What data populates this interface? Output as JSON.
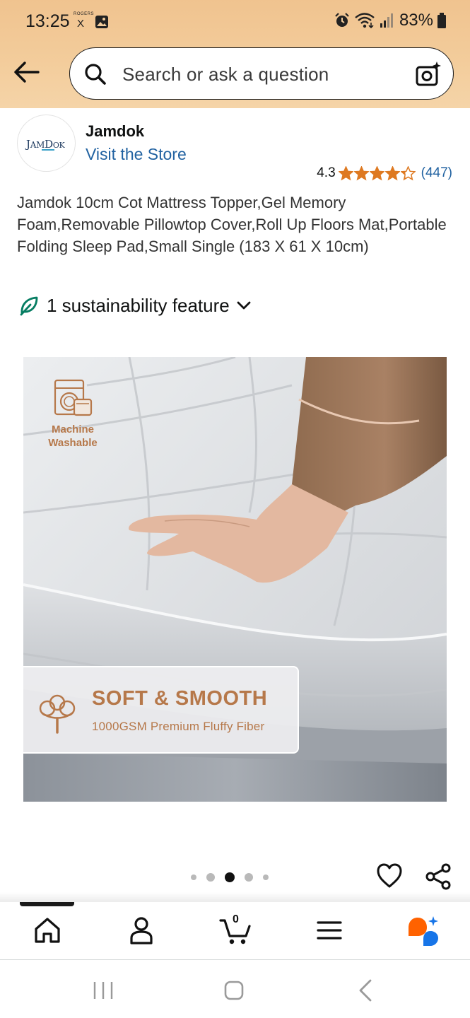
{
  "status_bar": {
    "time": "13:25",
    "carrier_label": "ROGERS",
    "carrier_mark": "X",
    "battery": "83%"
  },
  "search": {
    "placeholder": "Search or ask a question"
  },
  "brand": {
    "logo_text": "JAMDOK",
    "name": "Jamdok",
    "visit_store": "Visit the Store"
  },
  "rating": {
    "value": "4.3",
    "stars": 4.3,
    "max_stars": 5,
    "count": "(447)",
    "star_color": "#de7921"
  },
  "product": {
    "title": "Jamdok 10cm Cot Mattress Topper,Gel Memory Foam,Removable Pillowtop Cover,Roll Up Floors Mat,Portable Folding Sleep Pad,Small Single (183 X 61 X 10cm)"
  },
  "sustainability": {
    "label": "1 sustainability feature",
    "icon": "leaf-icon",
    "color": "#067d62"
  },
  "image": {
    "badge_label": "Machine Washable",
    "panel_title": "SOFT & SMOOTH",
    "panel_subtitle": "1000GSM Premium Fluffy Fiber",
    "accent_color": "#b6784a"
  },
  "carousel": {
    "total_images": 5,
    "active_index": 2
  },
  "bottom_nav": {
    "cart_count": "0",
    "items": [
      "home-icon",
      "account-icon",
      "cart-icon",
      "menu-icon",
      "rufus-icon"
    ]
  },
  "system_nav": {
    "items": [
      "recent-apps-icon",
      "home-button-icon",
      "back-icon"
    ]
  }
}
